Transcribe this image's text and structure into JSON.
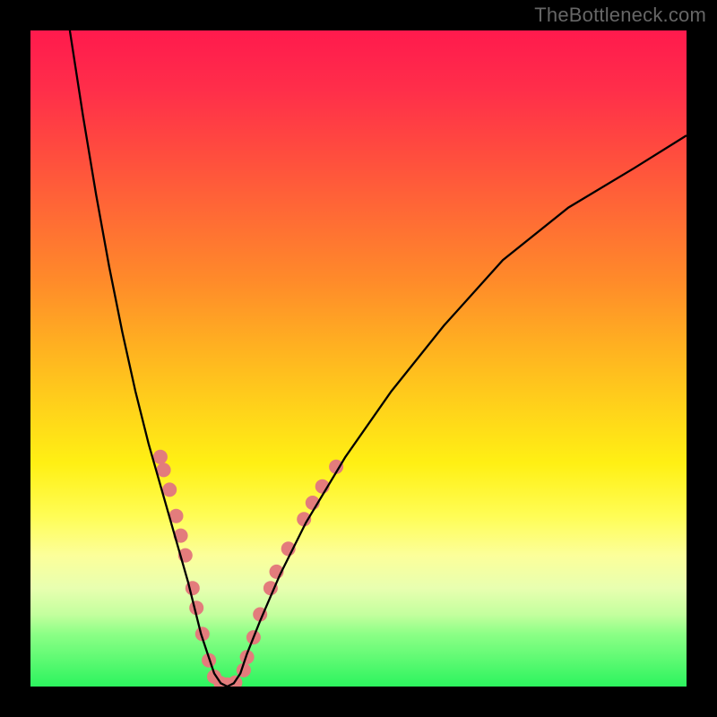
{
  "watermark": "TheBottleneck.com",
  "chart_data": {
    "type": "line",
    "title": "",
    "xlabel": "",
    "ylabel": "",
    "xlim": [
      0,
      100
    ],
    "ylim": [
      0,
      100
    ],
    "grid": false,
    "legend": false,
    "gradient_stops": [
      {
        "pct": 0,
        "color": "#ff1a4d"
      },
      {
        "pct": 9,
        "color": "#ff2e4a"
      },
      {
        "pct": 18,
        "color": "#ff4a3f"
      },
      {
        "pct": 28,
        "color": "#ff6a35"
      },
      {
        "pct": 38,
        "color": "#ff8a2a"
      },
      {
        "pct": 48,
        "color": "#ffb021"
      },
      {
        "pct": 58,
        "color": "#ffd41a"
      },
      {
        "pct": 66,
        "color": "#fff014"
      },
      {
        "pct": 74,
        "color": "#fffd55"
      },
      {
        "pct": 80,
        "color": "#fcff9a"
      },
      {
        "pct": 85,
        "color": "#e8ffb0"
      },
      {
        "pct": 89,
        "color": "#c4ff9e"
      },
      {
        "pct": 92,
        "color": "#8cff86"
      },
      {
        "pct": 100,
        "color": "#2cf45e"
      }
    ],
    "curve": {
      "name": "bottleneck-curve",
      "stroke": "#000000",
      "stroke_width": 2.3,
      "x": [
        6,
        8,
        10,
        12,
        14,
        16,
        18,
        20,
        22,
        24,
        25,
        26,
        27,
        28,
        29,
        30,
        31,
        32,
        33,
        35,
        38,
        42,
        48,
        55,
        63,
        72,
        82,
        92,
        100
      ],
      "y": [
        100,
        87,
        75,
        64,
        54,
        45,
        37,
        30,
        23,
        16,
        12,
        8,
        5,
        2,
        0.5,
        0,
        0.5,
        2,
        5,
        10,
        17,
        25,
        35,
        45,
        55,
        65,
        73,
        79,
        84
      ]
    },
    "markers": {
      "name": "sample-dots",
      "fill": "#e37c7c",
      "radius": 8,
      "points": [
        {
          "x": 19.8,
          "y": 35
        },
        {
          "x": 20.3,
          "y": 33
        },
        {
          "x": 21.2,
          "y": 30
        },
        {
          "x": 22.2,
          "y": 26
        },
        {
          "x": 22.9,
          "y": 23
        },
        {
          "x": 23.6,
          "y": 20
        },
        {
          "x": 24.7,
          "y": 15
        },
        {
          "x": 25.3,
          "y": 12
        },
        {
          "x": 26.2,
          "y": 8
        },
        {
          "x": 27.2,
          "y": 4
        },
        {
          "x": 28.0,
          "y": 1.5
        },
        {
          "x": 29.0,
          "y": 0.5
        },
        {
          "x": 30.0,
          "y": 0.3
        },
        {
          "x": 31.2,
          "y": 0.6
        },
        {
          "x": 32.5,
          "y": 2.5
        },
        {
          "x": 33.0,
          "y": 4.5
        },
        {
          "x": 34.0,
          "y": 7.5
        },
        {
          "x": 35.0,
          "y": 11
        },
        {
          "x": 36.6,
          "y": 15
        },
        {
          "x": 37.5,
          "y": 17.5
        },
        {
          "x": 39.3,
          "y": 21
        },
        {
          "x": 41.7,
          "y": 25.5
        },
        {
          "x": 43.0,
          "y": 28
        },
        {
          "x": 44.5,
          "y": 30.5
        },
        {
          "x": 46.6,
          "y": 33.5
        }
      ]
    }
  }
}
